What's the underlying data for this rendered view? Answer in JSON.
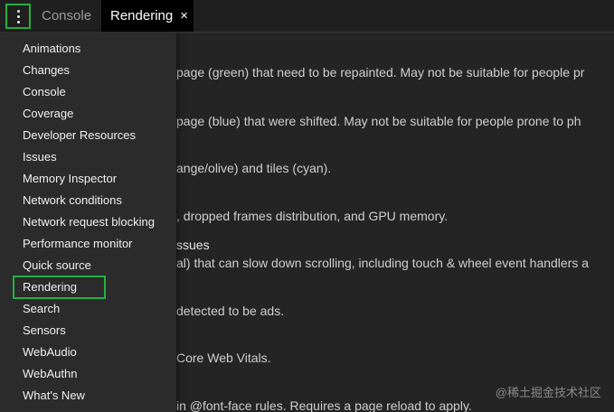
{
  "tabs": {
    "more_icon": "vertical-ellipsis-icon",
    "console_label": "Console",
    "rendering_label": "Rendering",
    "close_glyph": "×"
  },
  "panel": {
    "lines": [
      "page (green) that need to be repainted. May not be suitable for people pr",
      "page (blue) that were shifted. May not be suitable for people prone to ph",
      "ange/olive) and tiles (cyan).",
      ", dropped frames distribution, and GPU memory.",
      "ssues",
      "al) that can slow down scrolling, including touch & wheel event handlers a",
      "detected to be ads.",
      "Core Web Vitals.",
      "in @font-face rules. Requires a page reload to apply."
    ]
  },
  "menu": {
    "items": [
      "Animations",
      "Changes",
      "Console",
      "Coverage",
      "Developer Resources",
      "Issues",
      "Memory Inspector",
      "Network conditions",
      "Network request blocking",
      "Performance monitor",
      "Quick source",
      "Rendering",
      "Search",
      "Sensors",
      "WebAudio",
      "WebAuthn",
      "What's New"
    ],
    "highlighted_item": "Rendering"
  },
  "watermark": "@稀土掘金技术社区",
  "colors": {
    "highlight_border": "#27b043",
    "active_tab_bg": "#000000",
    "menu_bg": "#2b2b2b",
    "panel_bg": "#242424"
  }
}
